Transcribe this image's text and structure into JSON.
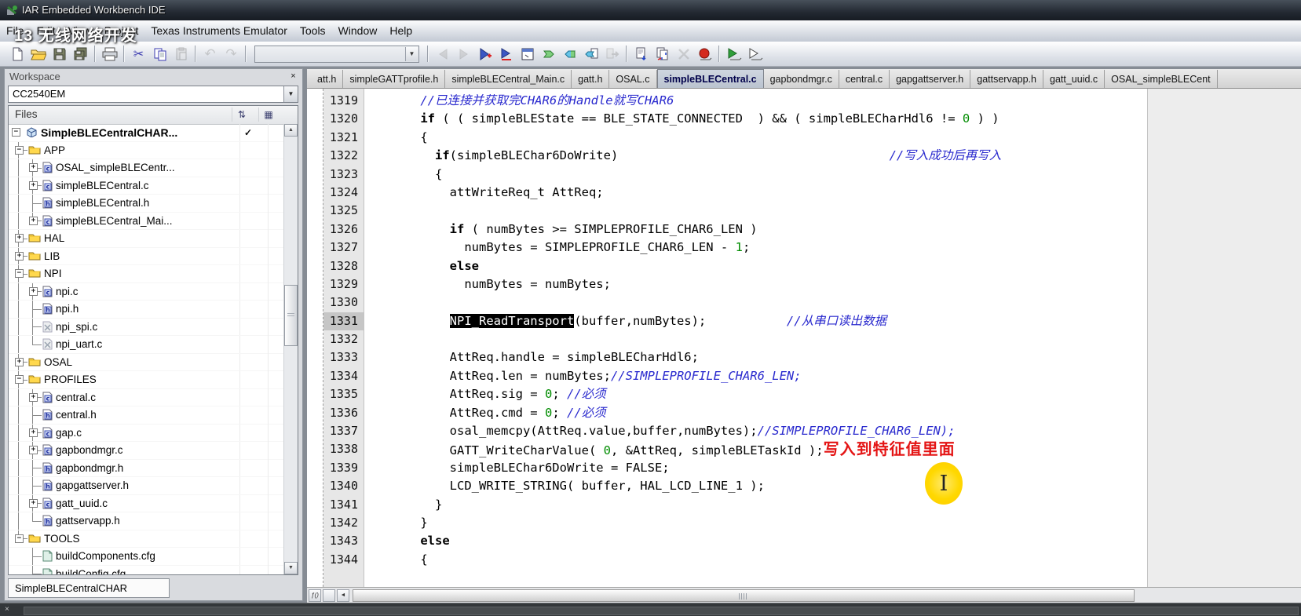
{
  "window": {
    "title": "IAR Embedded Workbench IDE"
  },
  "watermark": "13 无线网络开发",
  "menu": {
    "items": [
      "File",
      "Edit",
      "View",
      "Project",
      "Texas Instruments Emulator",
      "Tools",
      "Window",
      "Help"
    ]
  },
  "toolbar": {
    "groups": [
      {
        "items": [
          {
            "name": "new-file-icon"
          },
          {
            "name": "open-file-icon"
          },
          {
            "name": "save-icon"
          },
          {
            "name": "save-all-icon"
          }
        ]
      },
      {
        "items": [
          {
            "name": "print-icon"
          }
        ]
      },
      {
        "items": [
          {
            "name": "cut-icon"
          },
          {
            "name": "copy-icon"
          },
          {
            "name": "paste-icon",
            "disabled": true
          }
        ]
      },
      {
        "items": [
          {
            "name": "undo-icon",
            "disabled": true
          },
          {
            "name": "redo-icon",
            "disabled": true
          }
        ]
      },
      {
        "combo": true
      },
      {
        "items": [
          {
            "name": "nav-back-icon",
            "disabled": true
          },
          {
            "name": "nav-forward-icon",
            "disabled": true
          },
          {
            "name": "bookmark-toggle-icon"
          },
          {
            "name": "bookmark-next-icon"
          },
          {
            "name": "editor-window-icon"
          },
          {
            "name": "browse-forward-icon"
          },
          {
            "name": "go-back-icon"
          },
          {
            "name": "go-back-doc-icon"
          },
          {
            "name": "doc-forward-icon",
            "disabled": true
          }
        ]
      },
      {
        "items": [
          {
            "name": "compile-icon"
          },
          {
            "name": "make-icon"
          },
          {
            "name": "stop-build-icon",
            "disabled": true
          },
          {
            "name": "debug-red-icon"
          }
        ]
      },
      {
        "items": [
          {
            "name": "download-debug-icon"
          },
          {
            "name": "debug-without-download-icon"
          }
        ]
      }
    ],
    "find_combo_value": ""
  },
  "workspace": {
    "title": "Workspace",
    "config": "CC2540EM",
    "files_header": "Files",
    "bottom_tab": "SimpleBLECentralCHAR",
    "header_icons": [
      "sort-icon",
      "overlay-icon"
    ],
    "tree": [
      {
        "label": "SimpleBLECentralCHAR...",
        "type": "project",
        "level": 0,
        "exp": "minus",
        "bold": true,
        "check": true
      },
      {
        "label": "APP",
        "type": "folder",
        "level": 1,
        "exp": "minus"
      },
      {
        "label": "OSAL_simpleBLECentr...",
        "type": "cfile",
        "level": 2,
        "exp": "plus"
      },
      {
        "label": "simpleBLECentral.c",
        "type": "cfile",
        "level": 2,
        "exp": "plus"
      },
      {
        "label": "simpleBLECentral.h",
        "type": "hfile",
        "level": 2,
        "exp": "none"
      },
      {
        "label": "simpleBLECentral_Mai...",
        "type": "cfile",
        "level": 2,
        "exp": "plus"
      },
      {
        "label": "HAL",
        "type": "folder",
        "level": 1,
        "exp": "plus"
      },
      {
        "label": "LIB",
        "type": "folder",
        "level": 1,
        "exp": "plus"
      },
      {
        "label": "NPI",
        "type": "folder",
        "level": 1,
        "exp": "minus"
      },
      {
        "label": "npi.c",
        "type": "cfile",
        "level": 2,
        "exp": "plus"
      },
      {
        "label": "npi.h",
        "type": "hfile",
        "level": 2,
        "exp": "none"
      },
      {
        "label": "npi_spi.c",
        "type": "xfile",
        "level": 2,
        "exp": "none"
      },
      {
        "label": "npi_uart.c",
        "type": "xfile",
        "level": 2,
        "exp": "none"
      },
      {
        "label": "OSAL",
        "type": "folder",
        "level": 1,
        "exp": "plus"
      },
      {
        "label": "PROFILES",
        "type": "folder",
        "level": 1,
        "exp": "minus"
      },
      {
        "label": "central.c",
        "type": "cfile",
        "level": 2,
        "exp": "plus"
      },
      {
        "label": "central.h",
        "type": "hfile",
        "level": 2,
        "exp": "none"
      },
      {
        "label": "gap.c",
        "type": "cfile",
        "level": 2,
        "exp": "plus"
      },
      {
        "label": "gapbondmgr.c",
        "type": "cfile",
        "level": 2,
        "exp": "plus"
      },
      {
        "label": "gapbondmgr.h",
        "type": "hfile",
        "level": 2,
        "exp": "none"
      },
      {
        "label": "gapgattserver.h",
        "type": "hfile",
        "level": 2,
        "exp": "none"
      },
      {
        "label": "gatt_uuid.c",
        "type": "cfile",
        "level": 2,
        "exp": "plus"
      },
      {
        "label": "gattservapp.h",
        "type": "hfile",
        "level": 2,
        "exp": "none"
      },
      {
        "label": "TOOLS",
        "type": "folder",
        "level": 1,
        "exp": "minus"
      },
      {
        "label": "buildComponents.cfg",
        "type": "cfgfile",
        "level": 2,
        "exp": "none"
      },
      {
        "label": "buildConfig.cfg",
        "type": "cfgfile",
        "level": 2,
        "exp": "none"
      }
    ]
  },
  "editor": {
    "tabs": [
      {
        "label": "att.h"
      },
      {
        "label": "simpleGATTprofile.h"
      },
      {
        "label": "simpleBLECentral_Main.c"
      },
      {
        "label": "gatt.h"
      },
      {
        "label": "OSAL.c"
      },
      {
        "label": "simpleBLECentral.c",
        "active": true
      },
      {
        "label": "gapbondmgr.c"
      },
      {
        "label": "central.c"
      },
      {
        "label": "gapgattserver.h"
      },
      {
        "label": "gattservapp.h"
      },
      {
        "label": "gatt_uuid.c"
      },
      {
        "label": "OSAL_simpleBLECent"
      }
    ],
    "annotation_red": "写入到特征值里面",
    "colors": {
      "comment": "#2a2ace",
      "number": "#008c00",
      "annotation": "#e41414",
      "selection_bg": "#000000",
      "selection_fg": "#ffffff",
      "cursor_highlight": "#ffd800"
    },
    "lines": [
      {
        "n": 1319,
        "seg": [
          [
            "m",
            "    //已连接并获取完CHAR6的Handle就写CHAR6"
          ]
        ]
      },
      {
        "n": 1320,
        "seg": [
          [
            "c",
            "    "
          ],
          [
            "k",
            "if"
          ],
          [
            "c",
            " ( ( simpleBLEState == BLE_STATE_CONNECTED  ) && ( simpleBLECharHdl6 != "
          ],
          [
            "n",
            "0"
          ],
          [
            "c",
            " ) )"
          ]
        ]
      },
      {
        "n": 1321,
        "seg": [
          [
            "c",
            "    {"
          ]
        ]
      },
      {
        "n": 1322,
        "seg": [
          [
            "c",
            "      "
          ],
          [
            "k",
            "if"
          ],
          [
            "c",
            "(simpleBLEChar6DoWrite)                                     "
          ],
          [
            "m",
            "//写入成功后再写入"
          ]
        ]
      },
      {
        "n": 1323,
        "seg": [
          [
            "c",
            "      {"
          ]
        ]
      },
      {
        "n": 1324,
        "seg": [
          [
            "c",
            "        attWriteReq_t AttReq;"
          ]
        ]
      },
      {
        "n": 1325,
        "seg": []
      },
      {
        "n": 1326,
        "seg": [
          [
            "c",
            "        "
          ],
          [
            "k",
            "if"
          ],
          [
            "c",
            " ( numBytes >= SIMPLEPROFILE_CHAR6_LEN )"
          ]
        ]
      },
      {
        "n": 1327,
        "seg": [
          [
            "c",
            "          numBytes = SIMPLEPROFILE_CHAR6_LEN - "
          ],
          [
            "n",
            "1"
          ],
          [
            "c",
            ";"
          ]
        ]
      },
      {
        "n": 1328,
        "seg": [
          [
            "c",
            "        "
          ],
          [
            "k",
            "else"
          ]
        ]
      },
      {
        "n": 1329,
        "seg": [
          [
            "c",
            "          numBytes = numBytes;"
          ]
        ]
      },
      {
        "n": 1330,
        "seg": []
      },
      {
        "n": 1331,
        "cur": true,
        "seg": [
          [
            "c",
            "        "
          ],
          [
            "s",
            "NPI_ReadTransport"
          ],
          [
            "c",
            "(buffer,numBytes);           "
          ],
          [
            "m",
            "//从串口读出数据"
          ]
        ]
      },
      {
        "n": 1332,
        "seg": []
      },
      {
        "n": 1333,
        "seg": [
          [
            "c",
            "        AttReq.handle = simpleBLECharHdl6;"
          ]
        ]
      },
      {
        "n": 1334,
        "seg": [
          [
            "c",
            "        AttReq.len = numBytes;"
          ],
          [
            "m",
            "//SIMPLEPROFILE_CHAR6_LEN;"
          ]
        ]
      },
      {
        "n": 1335,
        "seg": [
          [
            "c",
            "        AttReq.sig = "
          ],
          [
            "n",
            "0"
          ],
          [
            "c",
            "; "
          ],
          [
            "m",
            "//必须"
          ]
        ]
      },
      {
        "n": 1336,
        "seg": [
          [
            "c",
            "        AttReq.cmd = "
          ],
          [
            "n",
            "0"
          ],
          [
            "c",
            "; "
          ],
          [
            "m",
            "//必须"
          ]
        ]
      },
      {
        "n": 1337,
        "seg": [
          [
            "c",
            "        osal_memcpy(AttReq.value,buffer,numBytes);"
          ],
          [
            "m",
            "//SIMPLEPROFILE_CHAR6_LEN);"
          ]
        ]
      },
      {
        "n": 1338,
        "seg": [
          [
            "c",
            "        GATT_WriteCharValue( "
          ],
          [
            "n",
            "0"
          ],
          [
            "c",
            ", &AttReq, simpleBLETaskId );"
          ],
          [
            "r",
            "写入到特征值里面"
          ]
        ]
      },
      {
        "n": 1339,
        "seg": [
          [
            "c",
            "        simpleBLEChar6DoWrite = FALSE;"
          ]
        ]
      },
      {
        "n": 1340,
        "seg": [
          [
            "c",
            "        LCD_WRITE_STRING( buffer, HAL_LCD_LINE_1 );"
          ]
        ]
      },
      {
        "n": 1341,
        "seg": [
          [
            "c",
            "      }"
          ]
        ]
      },
      {
        "n": 1342,
        "seg": [
          [
            "c",
            "    }"
          ]
        ]
      },
      {
        "n": 1343,
        "seg": [
          [
            "c",
            "    "
          ],
          [
            "k",
            "else"
          ]
        ]
      },
      {
        "n": 1344,
        "seg": [
          [
            "c",
            "    {"
          ]
        ]
      }
    ]
  },
  "scrollbars": {
    "editor_h_fn_button": "ƒ()",
    "left_arrow": "◄",
    "up_arrow": "▲",
    "down_arrow": "▼"
  },
  "statusbar": {
    "close": "×"
  }
}
